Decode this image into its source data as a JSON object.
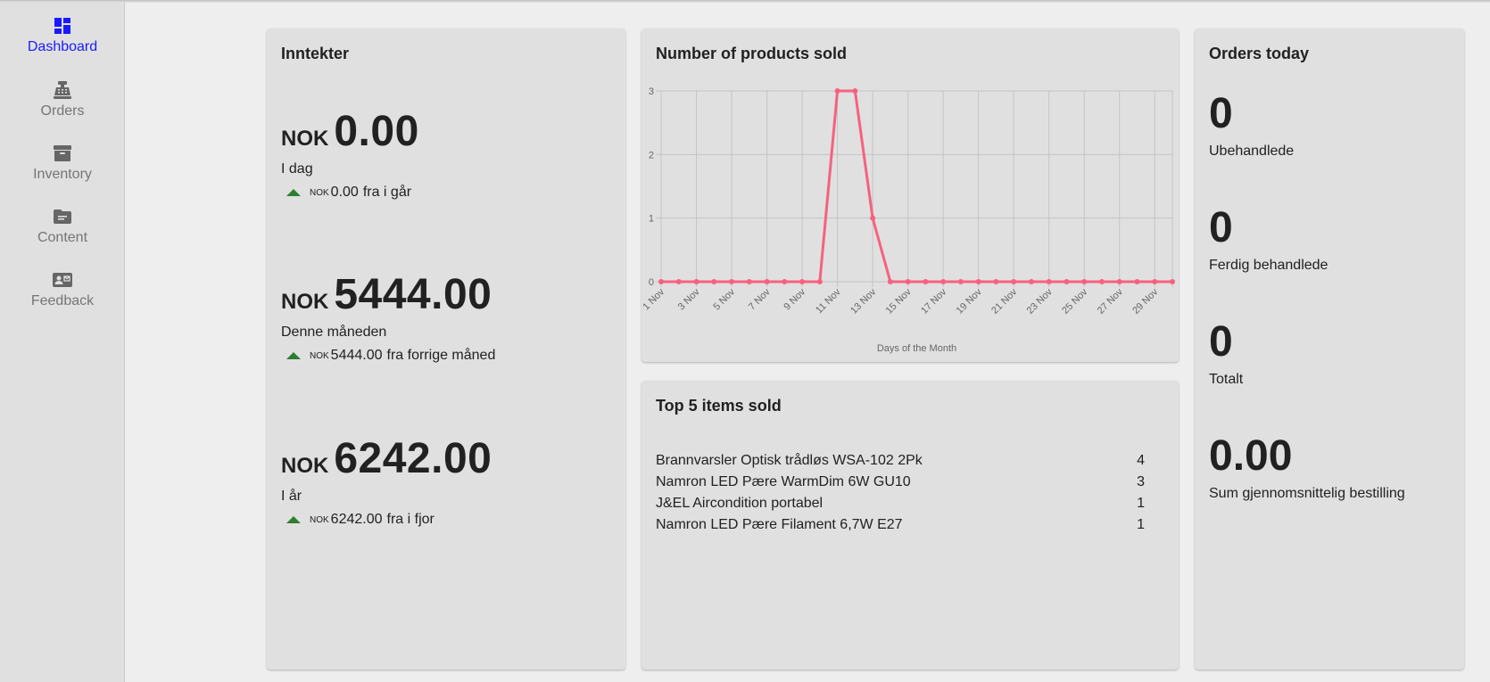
{
  "sidebar": {
    "items": [
      {
        "label": "Dashboard",
        "icon": "dashboard-icon"
      },
      {
        "label": "Orders",
        "icon": "cash-register-icon"
      },
      {
        "label": "Inventory",
        "icon": "archive-icon"
      },
      {
        "label": "Content",
        "icon": "folder-icon"
      },
      {
        "label": "Feedback",
        "icon": "contact-card-icon"
      }
    ],
    "active_color": "#1a1aff"
  },
  "revenue": {
    "title": "Inntekter",
    "blocks": [
      {
        "currency": "NOK",
        "amount": "0.00",
        "label": "I dag",
        "delta_currency": "NOK",
        "delta_amount": "0.00",
        "delta_text": "fra i går"
      },
      {
        "currency": "NOK",
        "amount": "5444.00",
        "label": "Denne måneden",
        "delta_currency": "NOK",
        "delta_amount": "5444.00",
        "delta_text": "fra forrige måned"
      },
      {
        "currency": "NOK",
        "amount": "6242.00",
        "label": "I år",
        "delta_currency": "NOK",
        "delta_amount": "6242.00",
        "delta_text": "fra i fjor"
      }
    ]
  },
  "products_chart": {
    "title": "Number of products sold"
  },
  "chart_data": {
    "type": "line",
    "title": "Number of products sold",
    "xlabel": "Days of the Month",
    "ylabel": "",
    "ylim": [
      0,
      3
    ],
    "yticks": [
      0,
      1,
      2,
      3
    ],
    "x": [
      "1 Nov",
      "2 Nov",
      "3 Nov",
      "4 Nov",
      "5 Nov",
      "6 Nov",
      "7 Nov",
      "8 Nov",
      "9 Nov",
      "10 Nov",
      "11 Nov",
      "12 Nov",
      "13 Nov",
      "14 Nov",
      "15 Nov",
      "16 Nov",
      "17 Nov",
      "18 Nov",
      "19 Nov",
      "20 Nov",
      "21 Nov",
      "22 Nov",
      "23 Nov",
      "24 Nov",
      "25 Nov",
      "26 Nov",
      "27 Nov",
      "28 Nov",
      "29 Nov",
      "30 Nov"
    ],
    "x_tick_labels": [
      "1 Nov",
      "3 Nov",
      "5 Nov",
      "7 Nov",
      "9 Nov",
      "11 Nov",
      "13 Nov",
      "15 Nov",
      "17 Nov",
      "19 Nov",
      "21 Nov",
      "23 Nov",
      "25 Nov",
      "27 Nov",
      "29 Nov"
    ],
    "series": [
      {
        "values": [
          0,
          0,
          0,
          0,
          0,
          0,
          0,
          0,
          0,
          0,
          3,
          3,
          1,
          0,
          0,
          0,
          0,
          0,
          0,
          0,
          0,
          0,
          0,
          0,
          0,
          0,
          0,
          0,
          0,
          0
        ],
        "color": "#f7617f"
      }
    ],
    "grid": true
  },
  "top_items": {
    "title": "Top 5 items sold",
    "rows": [
      {
        "name": "Brannvarsler Optisk trådløs WSA-102 2Pk",
        "count": "4"
      },
      {
        "name": "Namron LED Pære WarmDim 6W GU10",
        "count": "3"
      },
      {
        "name": "J&EL Aircondition portabel",
        "count": "1"
      },
      {
        "name": "Namron LED Pære Filament 6,7W E27",
        "count": "1"
      }
    ]
  },
  "orders_today": {
    "title": "Orders today",
    "stats": [
      {
        "value": "0",
        "label": "Ubehandlede"
      },
      {
        "value": "0",
        "label": "Ferdig behandlede"
      },
      {
        "value": "0",
        "label": "Totalt"
      },
      {
        "value": "0.00",
        "label": "Sum gjennomsnittelig bestilling"
      }
    ]
  }
}
